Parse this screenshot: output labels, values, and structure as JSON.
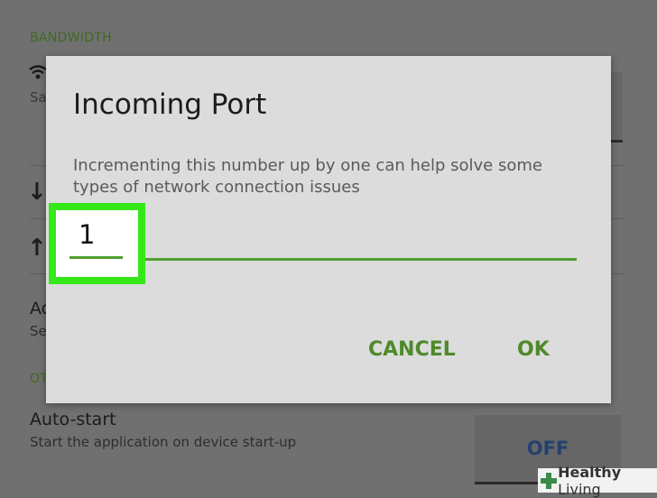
{
  "background": {
    "bandwidth_header": "BANDWIDTH",
    "sa_text": "Sa",
    "download_arrow": "↓",
    "upload_arrow": "↑",
    "ac_title": "Ac",
    "se_sub": "Se",
    "other_header": "OT",
    "autostart_title": "Auto-start",
    "autostart_sub": "Start the application on device start-up",
    "autostart_toggle": "OFF"
  },
  "dialog": {
    "title": "Incoming Port",
    "description": "Incrementing this number up by one can help solve some types of network connection issues",
    "port_value": "1",
    "cancel_label": "CANCEL",
    "ok_label": "OK"
  },
  "watermark": {
    "brand_bold": "Healthy",
    "brand_rest": " Living"
  },
  "colors": {
    "accent_green": "#4f9e2f",
    "highlight_green": "#35e818",
    "toggle_text": "#24406e"
  }
}
